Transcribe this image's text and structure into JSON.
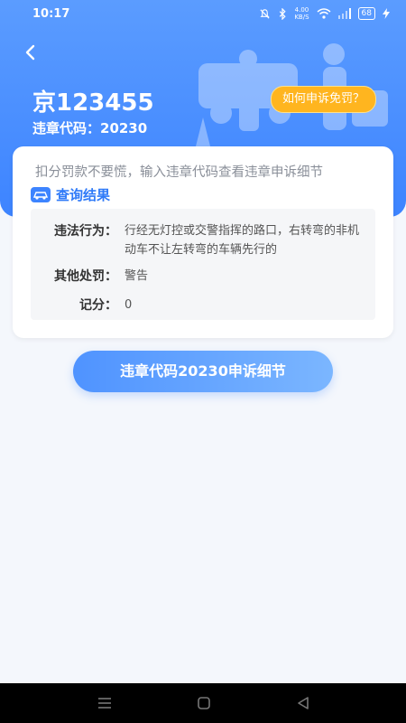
{
  "status_bar": {
    "time": "10:17",
    "net_speed_value": "4.00",
    "net_speed_unit": "KB/S",
    "battery": "68"
  },
  "header": {
    "plate": "京123455",
    "code_label": "违章代码：20230",
    "appeal_button": "如何申诉免罚？"
  },
  "card": {
    "tip": "扣分罚款不要慌，输入违章代码查看违章申诉细节",
    "result_title": "查询结果",
    "rows": [
      {
        "label": "违法行为：",
        "value": "行经无灯控或交警指挥的路口，右转弯的非机动车不让左转弯的车辆先行的"
      },
      {
        "label": "其他处罚：",
        "value": "警告"
      },
      {
        "label": "记分：",
        "value": "0"
      }
    ]
  },
  "main_button": "违章代码20230申诉细节",
  "colors": {
    "primary": "#3d84ff",
    "accent": "#ffb51f"
  }
}
